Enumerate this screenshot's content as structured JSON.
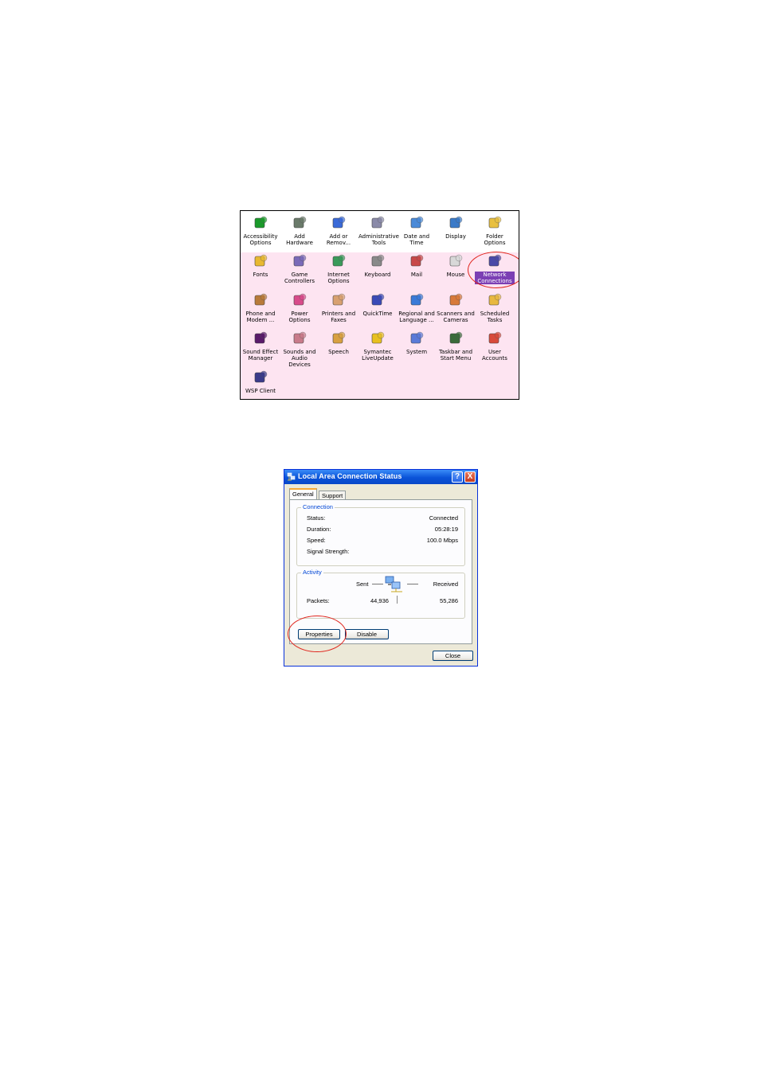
{
  "control_panel": {
    "items": [
      {
        "label": "Accessibility Options",
        "icon": "accessibility-icon",
        "color": "#1a9a2a"
      },
      {
        "label": "Add Hardware",
        "icon": "add-hardware-icon",
        "color": "#6a7a6a"
      },
      {
        "label": "Add or Remov...",
        "icon": "add-remove-programs-icon",
        "color": "#3a6ad8"
      },
      {
        "label": "Administrative Tools",
        "icon": "administrative-tools-icon",
        "color": "#8a8aa8"
      },
      {
        "label": "Date and Time",
        "icon": "date-time-icon",
        "color": "#4a8ad8"
      },
      {
        "label": "Display",
        "icon": "display-icon",
        "color": "#3a7ac8"
      },
      {
        "label": "Folder Options",
        "icon": "folder-options-icon",
        "color": "#e8c040"
      },
      {
        "label": "Fonts",
        "icon": "fonts-icon",
        "color": "#e8b830"
      },
      {
        "label": "Game Controllers",
        "icon": "game-controllers-icon",
        "color": "#7a6ab8"
      },
      {
        "label": "Internet Options",
        "icon": "internet-options-icon",
        "color": "#3a9a5a"
      },
      {
        "label": "Keyboard",
        "icon": "keyboard-icon",
        "color": "#8a8a8a"
      },
      {
        "label": "Mail",
        "icon": "mail-icon",
        "color": "#c84848"
      },
      {
        "label": "Mouse",
        "icon": "mouse-icon",
        "color": "#d8d8d8"
      },
      {
        "label": "Network Connections",
        "icon": "network-connections-icon",
        "color": "#4a4aa8",
        "selected": true
      },
      {
        "label": "Phone and Modem ...",
        "icon": "phone-modem-icon",
        "color": "#b87a3a"
      },
      {
        "label": "Power Options",
        "icon": "power-options-icon",
        "color": "#d84a8a"
      },
      {
        "label": "Printers and Faxes",
        "icon": "printers-faxes-icon",
        "color": "#d8a070"
      },
      {
        "label": "QuickTime",
        "icon": "quicktime-icon",
        "color": "#3a4ab8"
      },
      {
        "label": "Regional and Language ...",
        "icon": "regional-language-icon",
        "color": "#3a7ad8"
      },
      {
        "label": "Scanners and Cameras",
        "icon": "scanners-cameras-icon",
        "color": "#d87a3a"
      },
      {
        "label": "Scheduled Tasks",
        "icon": "scheduled-tasks-icon",
        "color": "#e8b840"
      },
      {
        "label": "Sound Effect Manager",
        "icon": "sound-effect-manager-icon",
        "color": "#5a1a6a"
      },
      {
        "label": "Sounds and Audio Devices",
        "icon": "sounds-audio-icon",
        "color": "#c87a8a"
      },
      {
        "label": "Speech",
        "icon": "speech-icon",
        "color": "#d8a040"
      },
      {
        "label": "Symantec LiveUpdate",
        "icon": "symantec-liveupdate-icon",
        "color": "#e8c020"
      },
      {
        "label": "System",
        "icon": "system-icon",
        "color": "#5a7ad8"
      },
      {
        "label": "Taskbar and Start Menu",
        "icon": "taskbar-start-menu-icon",
        "color": "#3a6a3a"
      },
      {
        "label": "User Accounts",
        "icon": "user-accounts-icon",
        "color": "#d84a3a"
      },
      {
        "label": "WSP Client",
        "icon": "wsp-client-icon",
        "color": "#3a3a8a"
      }
    ],
    "selected_color": "#7b3fb4",
    "highlight_color": "#e0241c",
    "background_color": "#fde4f1"
  },
  "dialog": {
    "title": "Local Area Connection Status",
    "help_label": "?",
    "close_glyph": "X",
    "tabs": [
      {
        "label": "General"
      },
      {
        "label": "Support"
      }
    ],
    "connection": {
      "legend": "Connection",
      "rows": [
        {
          "key": "Status:",
          "value": "Connected"
        },
        {
          "key": "Duration:",
          "value": "05:28:19"
        },
        {
          "key": "Speed:",
          "value": "100.0 Mbps"
        },
        {
          "key": "Signal Strength:",
          "value": ""
        }
      ]
    },
    "activity": {
      "legend": "Activity",
      "sent_label": "Sent",
      "received_label": "Received",
      "packets_label": "Packets:",
      "packets_sent": "44,936",
      "packets_received": "55,286"
    },
    "buttons": {
      "properties": "Properties",
      "disable": "Disable",
      "close": "Close"
    },
    "legend_color": "#0046d5",
    "titlebar_color": "#0a53d8"
  }
}
